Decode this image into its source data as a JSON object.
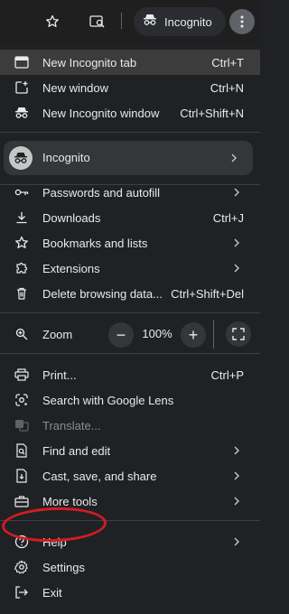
{
  "toolbar": {
    "profile_label": "Incognito",
    "icons": [
      "star-icon",
      "lens-icon",
      "incognito-icon",
      "kebab-menu-icon"
    ]
  },
  "menu": {
    "items_top": [
      {
        "label": "New Incognito tab",
        "shortcut": "Ctrl+T"
      },
      {
        "label": "New window",
        "shortcut": "Ctrl+N"
      },
      {
        "label": "New Incognito window",
        "shortcut": "Ctrl+Shift+N"
      }
    ],
    "profile": {
      "label": "Incognito"
    },
    "items_mid": [
      {
        "label": "Passwords and autofill",
        "shortcut": ""
      },
      {
        "label": "Downloads",
        "shortcut": "Ctrl+J"
      },
      {
        "label": "Bookmarks and lists",
        "shortcut": ""
      },
      {
        "label": "Extensions",
        "shortcut": ""
      },
      {
        "label": "Delete browsing data...",
        "shortcut": "Ctrl+Shift+Del"
      }
    ],
    "zoom": {
      "label": "Zoom",
      "value": "100%",
      "minus": "−",
      "plus": "+"
    },
    "items_tools": [
      {
        "label": "Print...",
        "shortcut": "Ctrl+P"
      },
      {
        "label": "Search with Google Lens",
        "shortcut": ""
      },
      {
        "label": "Translate...",
        "shortcut": ""
      },
      {
        "label": "Find and edit",
        "shortcut": ""
      },
      {
        "label": "Cast, save, and share",
        "shortcut": ""
      },
      {
        "label": "More tools",
        "shortcut": ""
      }
    ],
    "items_bottom": [
      {
        "label": "Help",
        "shortcut": ""
      },
      {
        "label": "Settings",
        "shortcut": ""
      },
      {
        "label": "Exit",
        "shortcut": ""
      }
    ]
  },
  "colors": {
    "background": "#202124",
    "highlight": "#3c3c3c",
    "annotation": "#d21c24"
  }
}
